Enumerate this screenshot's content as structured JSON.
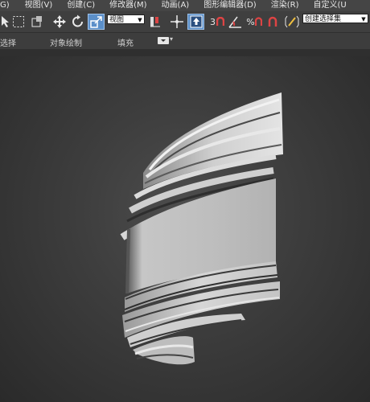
{
  "menu": {
    "items": [
      {
        "label": "G)"
      },
      {
        "label": "视图(V)"
      },
      {
        "label": "创建(C)"
      },
      {
        "label": "修改器(M)"
      },
      {
        "label": "动画(A)"
      },
      {
        "label": "图形编辑器(D)"
      },
      {
        "label": "渲染(R)"
      },
      {
        "label": "自定义(U"
      }
    ]
  },
  "toolbar": {
    "view_dropdown_value": "视图",
    "named_selection_value": "创建选择集",
    "snap_label": "3",
    "percent_label": "%"
  },
  "ribbon": {
    "tabs": [
      {
        "label": "选择"
      },
      {
        "label": "对象绘制"
      },
      {
        "label": "填充"
      }
    ]
  },
  "colors": {
    "accent": "#5b8fc9",
    "viewport_bg": "#3e3e3e",
    "model_light": "#d6d6d6",
    "model_shadow": "#3a3a3a"
  }
}
